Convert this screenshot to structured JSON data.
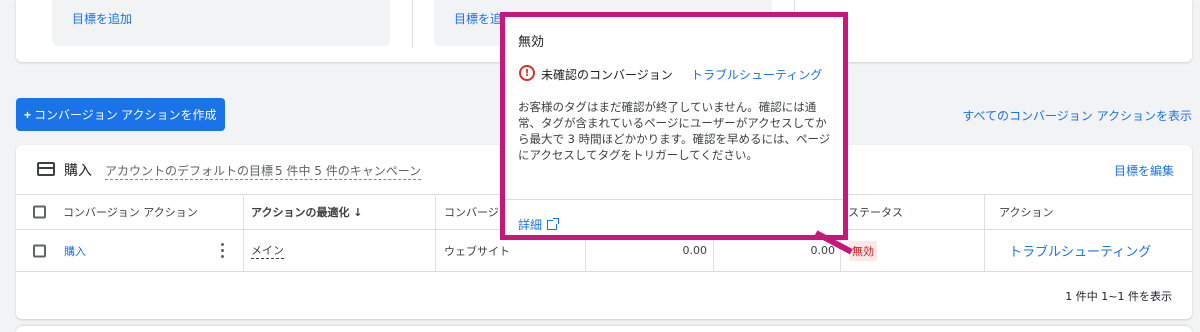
{
  "top_goals": {
    "goal1_link": "目標を追加",
    "goal2_link": "目標を追加"
  },
  "toolbar": {
    "create_plus": "+",
    "create_label": "コンバージョン アクションを作成",
    "show_all": "すべてのコンバージョン アクションを表示"
  },
  "card": {
    "title": "購入",
    "default_goal": "アカウントのデフォルトの目標",
    "campaign_count": "5 件中 5 件のキャンペーン",
    "edit_goal": "目標を編集"
  },
  "table": {
    "headers": {
      "action": "コンバージョン アクション",
      "optimization": "アクションの最適化 ↓",
      "source": "コンバージョン",
      "status": "ステータス",
      "actions": "アクション"
    },
    "row": {
      "name": "購入",
      "optimization": "メイン",
      "source": "ウェブサイト",
      "value1": "0.00",
      "value2": "0.00",
      "status": "無効",
      "action": "トラブルシューティング"
    },
    "pager": "1 件中 1~1 件を表示"
  },
  "tooltip": {
    "title": "無効",
    "warn_glyph": "!",
    "status": "未確認のコンバージョン",
    "trouble_link": "トラブルシューティング",
    "description": "お客様のタグはまだ確認が終了していません。確認には通常、タグが含まれているページにユーザーがアクセスしてから最大で 3 時間ほどかかります。確認を早めるには、ページにアクセスしてタグをトリガーしてください。",
    "details_link": "詳細"
  },
  "colors": {
    "accent": "#1a73e8",
    "highlight_border": "#c8177c",
    "error": "#d93025"
  }
}
